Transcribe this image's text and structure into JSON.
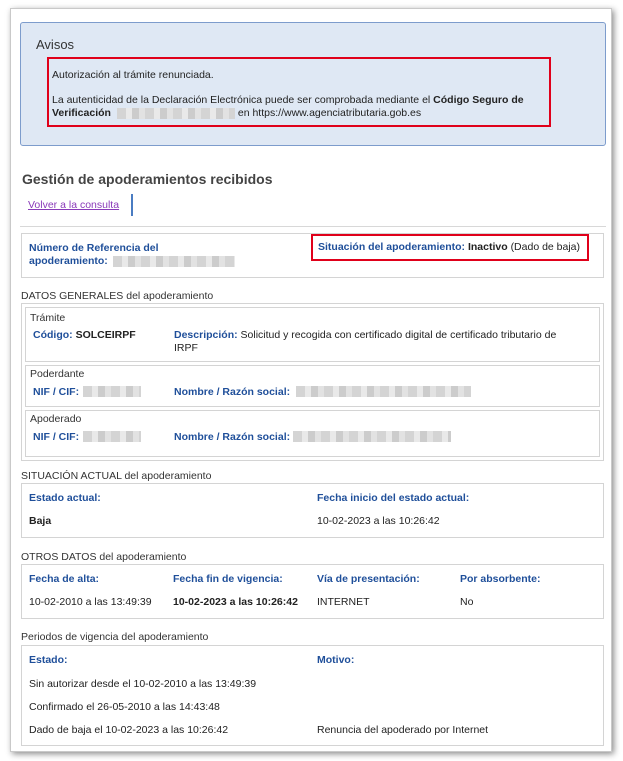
{
  "avisos": {
    "title": "Avisos",
    "line1": "Autorización al trámite renunciada.",
    "line2_pre": "La autenticidad de la Declaración Electrónica puede ser comprobada mediante el ",
    "line2_bold": "Código Seguro de",
    "line3_bold": "Verificación",
    "line3_post": " en https://www.agenciatributaria.gob.es"
  },
  "page": {
    "title": "Gestión de apoderamientos recibidos",
    "back_link": "Volver a la consulta"
  },
  "referencia": {
    "label_line1": "Número de Referencia del",
    "label_line2": "apoderamiento:",
    "situacion_label": "Situación del apoderamiento:",
    "situacion_value": "Inactivo",
    "situacion_note": "(Dado de baja)"
  },
  "datos_generales": {
    "title": "DATOS GENERALES del apoderamiento",
    "tramite": {
      "title": "Trámite",
      "codigo_label": "Código:",
      "codigo_value": "SOLCEIRPF",
      "descripcion_label": "Descripción:",
      "descripcion_line1": "Solicitud y recogida con certificado digital de certificado tributario de",
      "descripcion_line2": "IRPF"
    },
    "poderdante": {
      "title": "Poderdante",
      "nif_label": "NIF / CIF:",
      "nombre_label": "Nombre / Razón social:"
    },
    "apoderado": {
      "title": "Apoderado",
      "nif_label": "NIF / CIF:",
      "nombre_label": "Nombre / Razón social:"
    }
  },
  "situacion_actual": {
    "title": "SITUACIÓN ACTUAL del apoderamiento",
    "estado_label": "Estado actual:",
    "estado_value": "Baja",
    "fecha_label": "Fecha inicio del estado actual:",
    "fecha_value": "10-02-2023 a las 10:26:42"
  },
  "otros_datos": {
    "title": "OTROS DATOS del apoderamiento",
    "headers": [
      "Fecha de alta:",
      "Fecha fin de vigencia:",
      "Vía de presentación:",
      "Por absorbente:"
    ],
    "values": [
      "10-02-2010 a las 13:49:39",
      "10-02-2023 a las 10:26:42",
      "INTERNET",
      "No"
    ]
  },
  "periodos": {
    "title": "Periodos de vigencia del apoderamiento",
    "estado_label": "Estado:",
    "motivo_label": "Motivo:",
    "rows": [
      {
        "estado": "Sin autorizar desde el 10-02-2010 a las 13:49:39",
        "motivo": ""
      },
      {
        "estado": "Confirmado el 26-05-2010 a las 14:43:48",
        "motivo": ""
      },
      {
        "estado": "Dado de baja el 10-02-2023 a las 10:26:42",
        "motivo": "Renuncia del apoderado por Internet"
      }
    ]
  },
  "colors": {
    "label_blue": "#1f4f9a",
    "highlight_red": "#e0001a",
    "avisos_bg": "#dfe8f4",
    "link_purple": "#8a3ab9"
  }
}
